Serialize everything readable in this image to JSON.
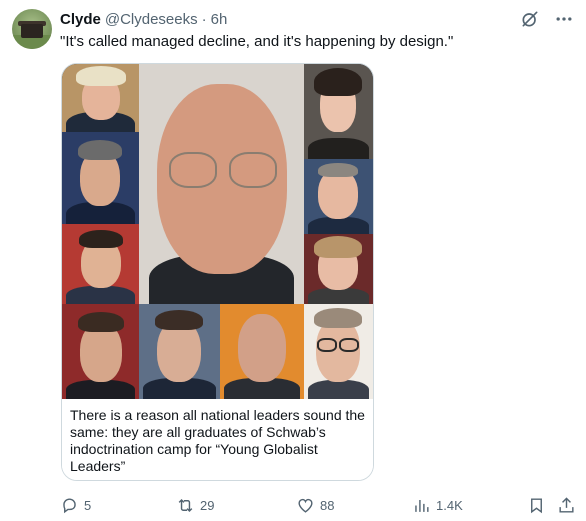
{
  "author": {
    "name": "Clyde",
    "handle": "@Clydeseeks",
    "separator": "·",
    "time": "6h"
  },
  "tweet": {
    "text": "\"It's called managed decline, and it's happening by design.\""
  },
  "media": {
    "caption": "There is a reason all national leaders sound the same: they are all graduates of Schwab’s indoctrination camp for “Young Globalist Leaders”"
  },
  "actions": {
    "replies": "5",
    "reposts": "29",
    "likes": "88",
    "views": "1.4K"
  },
  "icons": {
    "grok": "grok-icon",
    "more": "more-icon",
    "reply": "reply-icon",
    "repost": "repost-icon",
    "like": "heart-icon",
    "views": "views-icon",
    "bookmark": "bookmark-icon",
    "share": "share-icon"
  },
  "colors": {
    "text": "#0f1419",
    "secondary": "#536471",
    "border": "#cfd9de"
  }
}
